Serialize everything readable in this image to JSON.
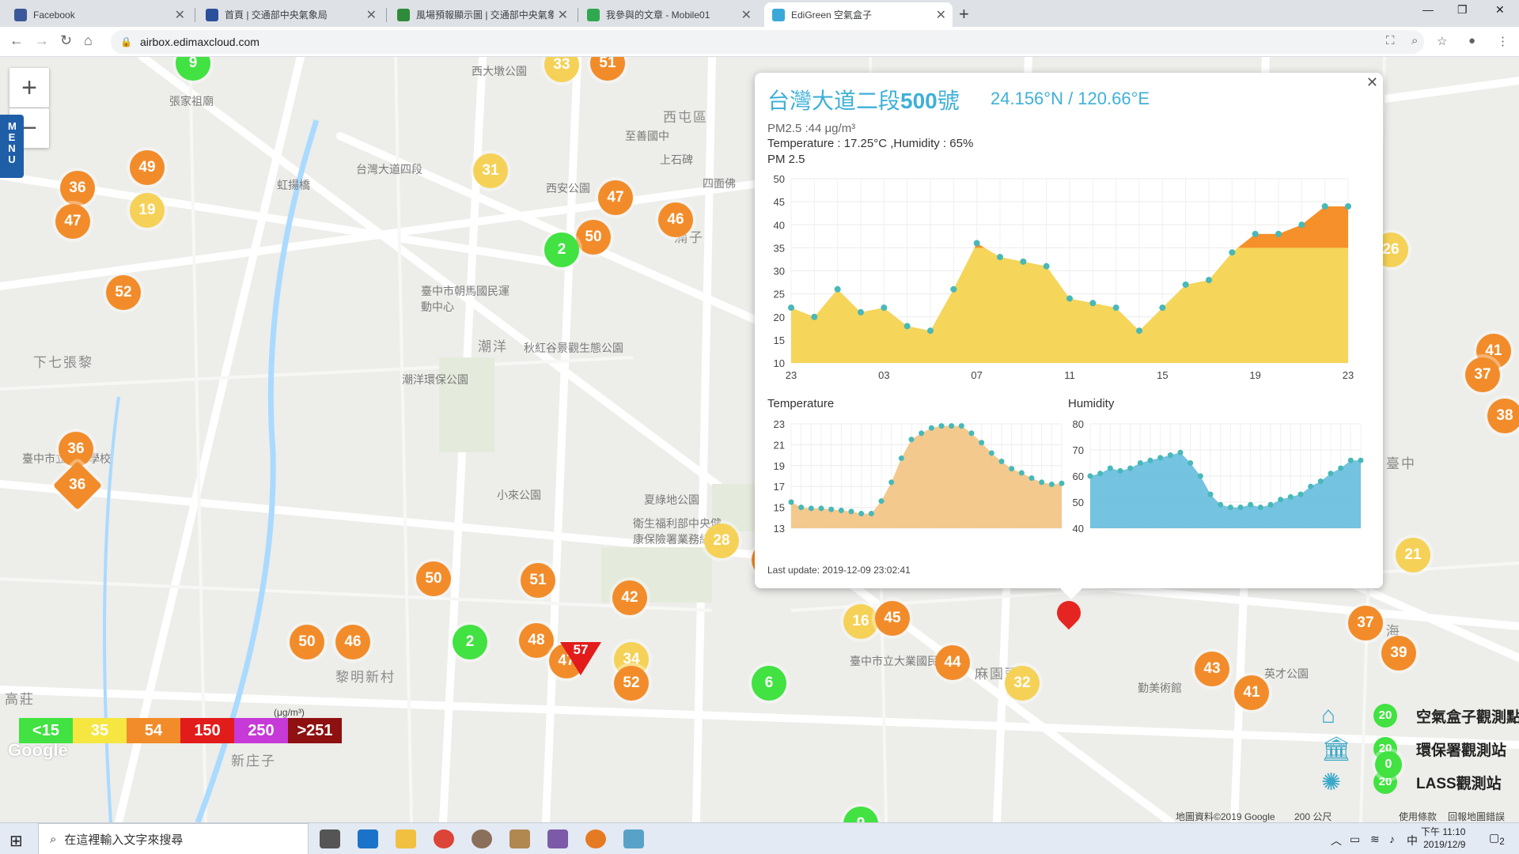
{
  "browser": {
    "tabs": [
      {
        "title": "Facebook",
        "active": false,
        "icon": "facebook-icon",
        "color": "#3b5998"
      },
      {
        "title": "首頁 | 交通部中央氣象局",
        "active": false,
        "icon": "eye-icon",
        "color": "#2b4f9a"
      },
      {
        "title": "風場預報顯示圖 | 交通部中央氣象局",
        "active": false,
        "icon": "leaf-icon",
        "color": "#2e8b3a"
      },
      {
        "title": "我參與的文章 - Mobile01",
        "active": false,
        "icon": "mobile01-icon",
        "color": "#2fa84f"
      },
      {
        "title": "EdiGreen 空氣盒子",
        "active": true,
        "icon": "edigreen-icon",
        "color": "#3aa8d8"
      }
    ],
    "url": "airbox.edimaxcloud.com"
  },
  "map": {
    "menu_label": "MENU",
    "labels": [
      {
        "text": "張家祖廟",
        "cls": ""
      },
      {
        "text": "西大墩公園",
        "cls": ""
      },
      {
        "text": "西屯區",
        "cls": "big"
      },
      {
        "text": "西安公園",
        "cls": ""
      },
      {
        "text": "台灣大道四段",
        "cls": ""
      },
      {
        "text": "虹揚橋",
        "cls": ""
      },
      {
        "text": "臺中市朝馬國民運動中心",
        "cls": ""
      },
      {
        "text": "潮洋",
        "cls": "big"
      },
      {
        "text": "秋紅谷景觀生態公園",
        "cls": ""
      },
      {
        "text": "下七張黎",
        "cls": "big"
      },
      {
        "text": "臺中市立啟聰學校",
        "cls": ""
      },
      {
        "text": "潮洋環保公園",
        "cls": ""
      },
      {
        "text": "小來公園",
        "cls": ""
      },
      {
        "text": "夏綠地公園",
        "cls": ""
      },
      {
        "text": "衛生福利部中央健康保險署業務組",
        "cls": ""
      },
      {
        "text": "黎明新村",
        "cls": "big"
      },
      {
        "text": "高莊",
        "cls": "big"
      },
      {
        "text": "臺中市立大業國民中學",
        "cls": ""
      },
      {
        "text": "麻園頭",
        "cls": "big"
      },
      {
        "text": "勤美術館",
        "cls": ""
      },
      {
        "text": "英才公園",
        "cls": ""
      },
      {
        "text": "中 海",
        "cls": "big"
      },
      {
        "text": "臺中",
        "cls": "big"
      },
      {
        "text": "新庄子",
        "cls": "big"
      },
      {
        "text": "上石碑",
        "cls": ""
      },
      {
        "text": "四面佛",
        "cls": ""
      },
      {
        "text": "至善國中",
        "cls": ""
      },
      {
        "text": "湳子",
        "cls": "big"
      }
    ],
    "markers": [
      {
        "v": "9",
        "c": "g"
      },
      {
        "v": "33",
        "c": "y"
      },
      {
        "v": "51",
        "c": "o"
      },
      {
        "v": "49",
        "c": "o"
      },
      {
        "v": "31",
        "c": "y"
      },
      {
        "v": "36",
        "c": "o"
      },
      {
        "v": "19",
        "c": "y"
      },
      {
        "v": "47",
        "c": "o"
      },
      {
        "v": "47",
        "c": "o"
      },
      {
        "v": "46",
        "c": "o"
      },
      {
        "v": "50",
        "c": "o"
      },
      {
        "v": "2",
        "c": "g"
      },
      {
        "v": "52",
        "c": "o"
      },
      {
        "v": "36",
        "c": "o"
      },
      {
        "v": "28",
        "c": "y"
      },
      {
        "v": "42",
        "c": "o"
      },
      {
        "v": "50",
        "c": "o"
      },
      {
        "v": "51",
        "c": "o"
      },
      {
        "v": "42",
        "c": "o"
      },
      {
        "v": "50",
        "c": "o"
      },
      {
        "v": "46",
        "c": "o"
      },
      {
        "v": "2",
        "c": "g"
      },
      {
        "v": "48",
        "c": "o"
      },
      {
        "v": "47",
        "c": "o"
      },
      {
        "v": "34",
        "c": "y"
      },
      {
        "v": "52",
        "c": "o"
      },
      {
        "v": "44",
        "c": "o"
      },
      {
        "v": "16",
        "c": "y"
      },
      {
        "v": "45",
        "c": "o"
      },
      {
        "v": "6",
        "c": "g"
      },
      {
        "v": "44",
        "c": "o"
      },
      {
        "v": "32",
        "c": "y"
      },
      {
        "v": "43",
        "c": "o"
      },
      {
        "v": "41",
        "c": "o"
      },
      {
        "v": "26",
        "c": "y"
      },
      {
        "v": "41",
        "c": "o"
      },
      {
        "v": "37",
        "c": "o"
      },
      {
        "v": "38",
        "c": "o"
      },
      {
        "v": "21",
        "c": "y"
      },
      {
        "v": "18",
        "c": "y"
      },
      {
        "v": "37",
        "c": "o"
      },
      {
        "v": "39",
        "c": "o"
      },
      {
        "v": "9",
        "c": "g"
      },
      {
        "v": "57",
        "c": "o"
      }
    ],
    "legend": [
      {
        "label": "<15",
        "color": "#41e241"
      },
      {
        "label": "35",
        "color": "#f5e642"
      },
      {
        "label": "54",
        "color": "#f28c2a"
      },
      {
        "label": "150",
        "color": "#e21b1b"
      },
      {
        "label": "250",
        "color": "#c63ad8"
      },
      {
        "label": ">251",
        "color": "#8e1010"
      }
    ],
    "legend_unit": "(μg/m³)",
    "station_legend": [
      {
        "label": "空氣盒子觀測點",
        "icon": "airbox-icon",
        "badge": "20"
      },
      {
        "label": "環保署觀測站",
        "icon": "building-icon",
        "badge": "20"
      },
      {
        "label": "LASS觀測站",
        "icon": "lass-icon",
        "badge": "20"
      }
    ],
    "extra_badge": "0",
    "footer": {
      "data": "地圖資料©2019 Google",
      "scale": "200 公尺",
      "terms": "使用條款",
      "report": "回報地圖錯誤"
    },
    "google_logo": "Google"
  },
  "popup": {
    "title_prefix": "台灣大道二段",
    "title_number": "500",
    "title_suffix": "號",
    "coords": "24.156°N / 120.66°E",
    "pm25_line": "PM2.5 :44 μg/m³",
    "temp_hum_line": "Temperature : 17.25°C ,Humidity : 65%",
    "pm_chart_title": "PM 2.5",
    "temp_chart_title": "Temperature",
    "hum_chart_title": "Humidity",
    "last_update": "Last update: 2019-12-09 23:02:41"
  },
  "chart_data": [
    {
      "type": "area",
      "title": "PM 2.5",
      "x_ticks": [
        "23",
        "03",
        "07",
        "11",
        "15",
        "19",
        "23"
      ],
      "y_ticks": [
        10,
        15,
        20,
        25,
        30,
        35,
        40,
        45,
        50
      ],
      "ylim": [
        10,
        50
      ],
      "threshold": 35,
      "colors": {
        "below": "#f5d55a",
        "above": "#f5902a",
        "point": "#48b8b8"
      },
      "values": [
        22,
        20,
        26,
        21,
        22,
        18,
        17,
        26,
        36,
        33,
        32,
        31,
        24,
        23,
        22,
        17,
        22,
        27,
        28,
        34,
        38,
        38,
        40,
        44,
        44
      ]
    },
    {
      "type": "area",
      "title": "Temperature",
      "y_ticks": [
        13,
        15,
        17,
        19,
        21,
        23
      ],
      "ylim": [
        13,
        23
      ],
      "colors": {
        "fill": "#f2c07a",
        "point": "#48b8b8"
      },
      "values": [
        15.5,
        15,
        14.9,
        14.9,
        14.8,
        14.7,
        14.6,
        14.4,
        14.4,
        15.6,
        17.4,
        19.7,
        21.5,
        22.1,
        22.6,
        22.8,
        22.8,
        22.8,
        22.1,
        21.2,
        20.2,
        19.4,
        18.7,
        18.3,
        17.8,
        17.4,
        17.2,
        17.3
      ]
    },
    {
      "type": "area",
      "title": "Humidity",
      "y_ticks": [
        40,
        50,
        60,
        70,
        80
      ],
      "ylim": [
        40,
        80
      ],
      "colors": {
        "fill": "#5bb8dc",
        "point": "#48b8b8"
      },
      "values": [
        60,
        61,
        63,
        62,
        63,
        65,
        66,
        67,
        68,
        69,
        65,
        60,
        53,
        49,
        48,
        48,
        49,
        48,
        49,
        51,
        52,
        53,
        56,
        58,
        61,
        63,
        66,
        66
      ]
    }
  ],
  "taskbar": {
    "search_placeholder": "在這裡輸入文字來搜尋",
    "ime": "中",
    "time": "下午 11:10",
    "date": "2019/12/9",
    "notification_count": "2"
  }
}
